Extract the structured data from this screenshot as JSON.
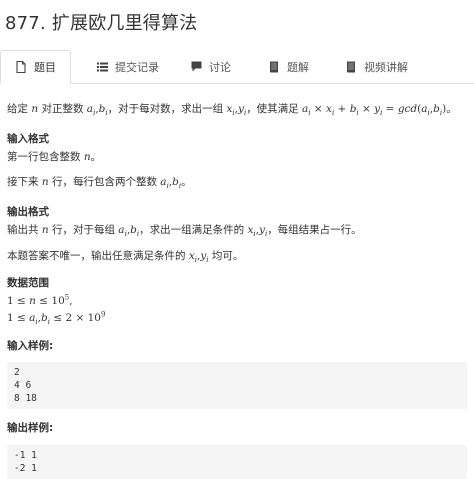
{
  "page": {
    "title": "877. 扩展欧几里得算法"
  },
  "tabs": [
    {
      "label": "题目",
      "icon": "document-icon",
      "active": true
    },
    {
      "label": "提交记录",
      "icon": "list-icon",
      "active": false
    },
    {
      "label": "讨论",
      "icon": "comment-icon",
      "active": false
    },
    {
      "label": "题解",
      "icon": "book-icon",
      "active": false
    },
    {
      "label": "视频讲解",
      "icon": "book-icon",
      "active": false
    }
  ],
  "problem": {
    "desc_1": "给定 ",
    "desc_n": "n",
    "desc_2": " 对正整数 ",
    "desc_ai": "a",
    "desc_i": "i",
    "desc_comma": ",",
    "desc_bi": "b",
    "desc_3": "，对于每对数，求出一组 ",
    "desc_x": "x",
    "desc_y": "y",
    "desc_4": "，使其满足 ",
    "formula_a": "a",
    "formula_times": " × ",
    "formula_x": "x",
    "formula_plus": " + ",
    "formula_b": "b",
    "formula_y": "y",
    "formula_eq": " = ",
    "formula_gcd": "gcd",
    "formula_lp": "(",
    "formula_rp": ")",
    "desc_end": "。",
    "input_format_heading": "输入格式",
    "input_line_1a": "第一行包含整数 ",
    "input_line_1b": "。",
    "input_line_2a": "接下来 ",
    "input_line_2b": " 行，每行包含两个整数 ",
    "input_line_2c": "。",
    "output_format_heading": "输出格式",
    "output_line_1a": "输出共 ",
    "output_line_1b": " 行，对于每组 ",
    "output_line_1c": "，求出一组满足条件的 ",
    "output_line_1d": "，每组结果占一行。",
    "output_line_2a": "本题答案不唯一，输出任意满足条件的 ",
    "output_line_2b": " 均可。",
    "range_heading": "数据范围",
    "range_1_lhs": "1 ≤ ",
    "range_1_n": "n",
    "range_1_rhs": " ≤ 10",
    "range_1_exp": "5",
    "range_1_end": ",",
    "range_2_lhs": "1 ≤ ",
    "range_2_rhs": " ≤ 2 × 10",
    "range_2_exp": "9",
    "sample_input_heading": "输入样例:",
    "sample_input": "2\n4 6\n8 18",
    "sample_output_heading": "输出样例:",
    "sample_output": "-1 1\n-2 1"
  }
}
